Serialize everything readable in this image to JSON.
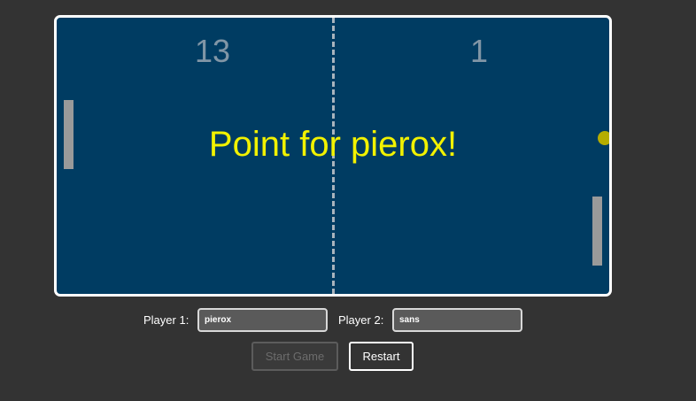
{
  "game": {
    "score_left": "13",
    "score_right": "1",
    "message": "Point for pierox!",
    "colors": {
      "court": "#003c62",
      "message": "#f2f200",
      "ball": "#b6ad00",
      "paddle": "#9a9a9a",
      "score": "#8196a6"
    }
  },
  "players": {
    "p1_label": "Player 1:",
    "p1_name": "pierox",
    "p2_label": "Player 2:",
    "p2_name": "sans"
  },
  "buttons": {
    "start_label": "Start Game",
    "restart_label": "Restart"
  }
}
